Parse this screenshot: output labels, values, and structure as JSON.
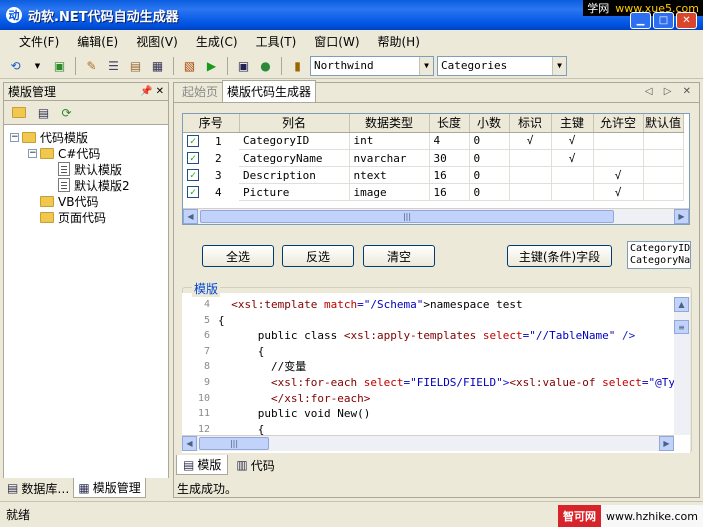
{
  "window": {
    "title": "动软.NET代码自动生成器"
  },
  "watermarks": {
    "top_site": "学网",
    "top_url": "www.xue5.com",
    "bottom_site": "智可网",
    "bottom_url": "www.hzhike.com"
  },
  "menu": [
    "文件(F)",
    "编辑(E)",
    "视图(V)",
    "生成(C)",
    "工具(T)",
    "窗口(W)",
    "帮助(H)"
  ],
  "toolbar": {
    "database_combo": "Northwind",
    "table_combo": "Categories"
  },
  "left_panel": {
    "title": "模版管理",
    "tree": [
      {
        "label": "代码模版",
        "level": 0,
        "type": "folder",
        "toggle": "−"
      },
      {
        "label": "C#代码",
        "level": 1,
        "type": "folder",
        "toggle": "−"
      },
      {
        "label": "默认模版",
        "level": 2,
        "type": "file"
      },
      {
        "label": "默认模版2",
        "level": 2,
        "type": "file"
      },
      {
        "label": "VB代码",
        "level": 1,
        "type": "folder"
      },
      {
        "label": "页面代码",
        "level": 1,
        "type": "folder"
      }
    ],
    "tabs": [
      "数据库…",
      "模版管理"
    ]
  },
  "doc_tabs": {
    "start": "起始页",
    "active": "模版代码生成器"
  },
  "columns_table": {
    "headers": [
      "序号",
      "列名",
      "数据类型",
      "长度",
      "小数",
      "标识",
      "主键",
      "允许空",
      "默认值"
    ],
    "rows": [
      {
        "no": "1",
        "name": "CategoryID",
        "type": "int",
        "len": "4",
        "dec": "0",
        "identity": "√",
        "pk": "√",
        "nullable": ""
      },
      {
        "no": "2",
        "name": "CategoryName",
        "type": "nvarchar",
        "len": "30",
        "dec": "0",
        "identity": "",
        "pk": "√",
        "nullable": ""
      },
      {
        "no": "3",
        "name": "Description",
        "type": "ntext",
        "len": "16",
        "dec": "0",
        "identity": "",
        "pk": "",
        "nullable": "√"
      },
      {
        "no": "4",
        "name": "Picture",
        "type": "image",
        "len": "16",
        "dec": "0",
        "identity": "",
        "pk": "",
        "nullable": "√"
      }
    ]
  },
  "buttons": {
    "select_all": "全选",
    "invert": "反选",
    "clear": "清空",
    "pk_field": "主键(条件)字段"
  },
  "pk_list": [
    "CategoryID",
    "CategoryNa"
  ],
  "template_group": "模版",
  "editor": {
    "line_numbers": [
      "4",
      "5",
      "6",
      "7",
      "8",
      "9",
      "10",
      "11",
      "12"
    ],
    "lines": [
      [
        {
          "t": "  ",
          "c": ""
        },
        {
          "t": "<xsl:template ",
          "c": "kw"
        },
        {
          "t": "match",
          "c": "at"
        },
        {
          "t": "=\"/Schema\"",
          "c": "st"
        },
        {
          "t": ">namespace test",
          "c": ""
        }
      ],
      [
        {
          "t": "{",
          "c": ""
        }
      ],
      [
        {
          "t": "      public class ",
          "c": ""
        },
        {
          "t": "<xsl:apply-templates ",
          "c": "kw"
        },
        {
          "t": "select",
          "c": "at"
        },
        {
          "t": "=\"//TableName\"",
          "c": "st"
        },
        {
          "t": " />",
          "c": "br"
        }
      ],
      [
        {
          "t": "      {",
          "c": ""
        }
      ],
      [
        {
          "t": "        //变量",
          "c": ""
        }
      ],
      [
        {
          "t": "        ",
          "c": ""
        },
        {
          "t": "<xsl:for-each ",
          "c": "kw"
        },
        {
          "t": "select",
          "c": "at"
        },
        {
          "t": "=\"FIELDS/FIELD\"",
          "c": "st"
        },
        {
          "t": ">",
          "c": "br"
        },
        {
          "t": "<xsl:value-of ",
          "c": "kw"
        },
        {
          "t": "select",
          "c": "at"
        },
        {
          "t": "=\"@Type\"",
          "c": "st"
        },
        {
          "t": " /",
          "c": "br"
        }
      ],
      [
        {
          "t": "        ",
          "c": ""
        },
        {
          "t": "</xsl:for-each>",
          "c": "kw"
        }
      ],
      [
        {
          "t": "      public void New()",
          "c": ""
        }
      ],
      [
        {
          "t": "      {",
          "c": ""
        }
      ]
    ]
  },
  "bottom_tabs": [
    "模版",
    "代码"
  ],
  "output": "生成成功。",
  "status": "就绪"
}
